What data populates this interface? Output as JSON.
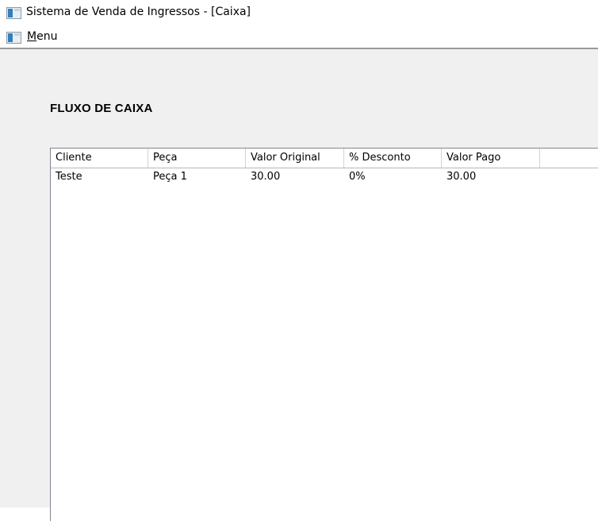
{
  "window": {
    "title": "Sistema de Venda de Ingressos - [Caixa]",
    "icon": "app-window-icon"
  },
  "menubar": {
    "icon": "mdi-child-icon",
    "menu_label_mnemonic": "M",
    "menu_label_rest": "enu"
  },
  "page": {
    "title": "FLUXO DE CAIXA"
  },
  "table": {
    "columns": [
      "Cliente",
      "Peça",
      "Valor Original",
      "% Desconto",
      "Valor Pago"
    ],
    "rows": [
      [
        "Teste",
        "Peça 1",
        "30.00",
        "0%",
        "30.00"
      ]
    ]
  }
}
